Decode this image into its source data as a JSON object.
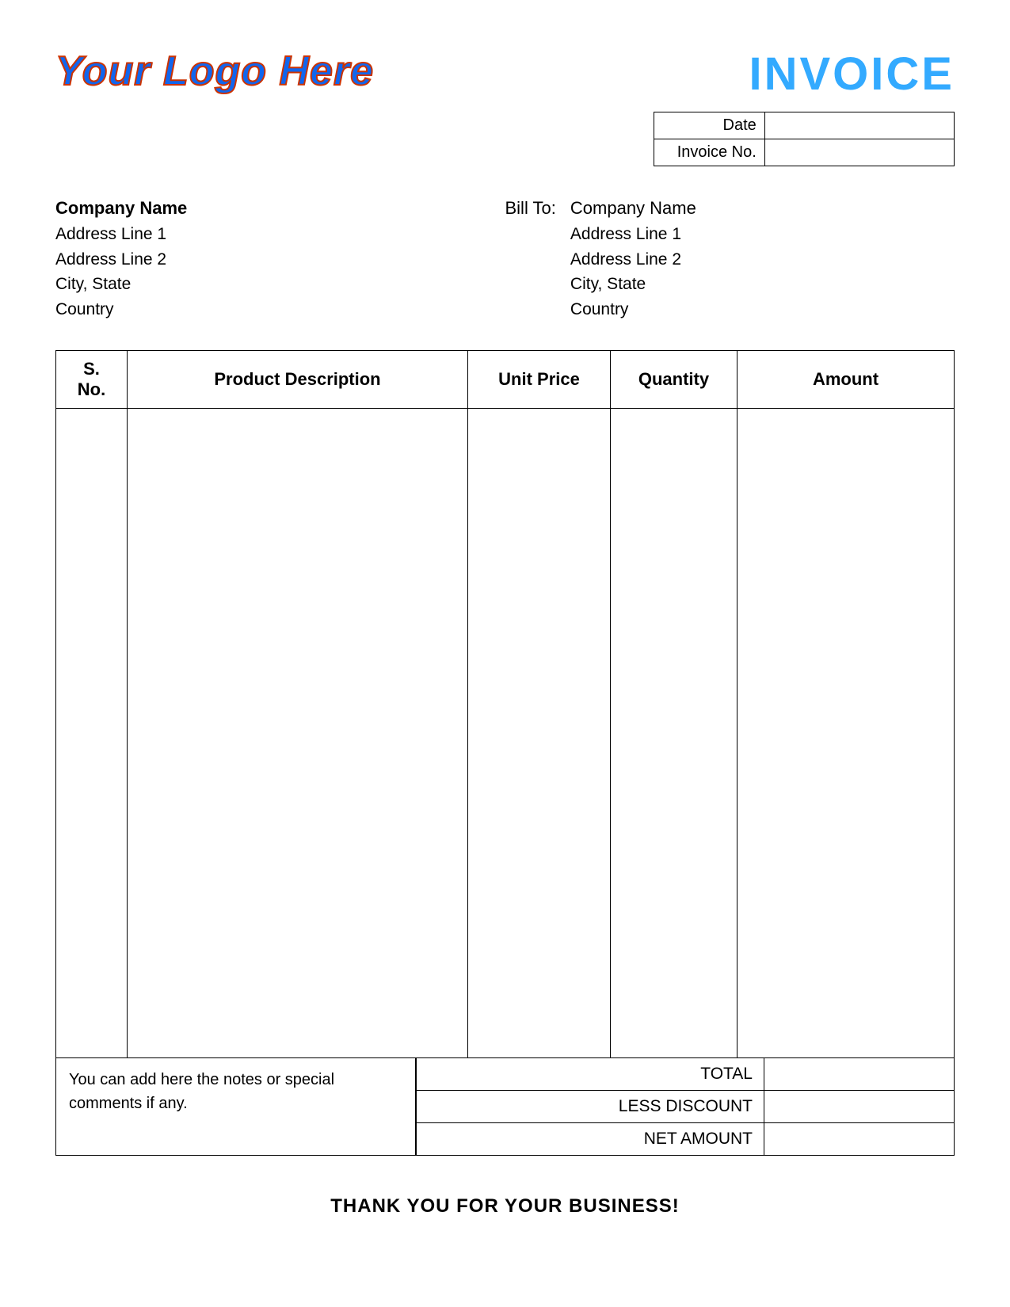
{
  "header": {
    "logo_text": "Your Logo Here",
    "invoice_title": "INVOICE"
  },
  "meta": {
    "date_label": "Date",
    "invoice_no_label": "Invoice No.",
    "date_value": "",
    "invoice_no_value": ""
  },
  "from": {
    "company_name": "Company Name",
    "address_line1": "Address Line 1",
    "address_line2": "Address Line 2",
    "city_state": "City, State",
    "country": "Country"
  },
  "bill_to": {
    "label": "Bill To:",
    "company_name": "Company Name",
    "address_line1": "Address Line 1",
    "address_line2": "Address Line 2",
    "city_state": "City, State",
    "country": "Country"
  },
  "table": {
    "headers": {
      "sno": "S. No.",
      "description": "Product Description",
      "unit_price": "Unit Price",
      "quantity": "Quantity",
      "amount": "Amount"
    }
  },
  "totals": {
    "total_label": "TOTAL",
    "discount_label": "LESS DISCOUNT",
    "net_amount_label": "NET AMOUNT",
    "total_value": "",
    "discount_value": "",
    "net_amount_value": ""
  },
  "notes": {
    "text": "You can add here the notes or special comments if any."
  },
  "footer": {
    "text": "THANK YOU FOR YOUR BUSINESS!"
  }
}
